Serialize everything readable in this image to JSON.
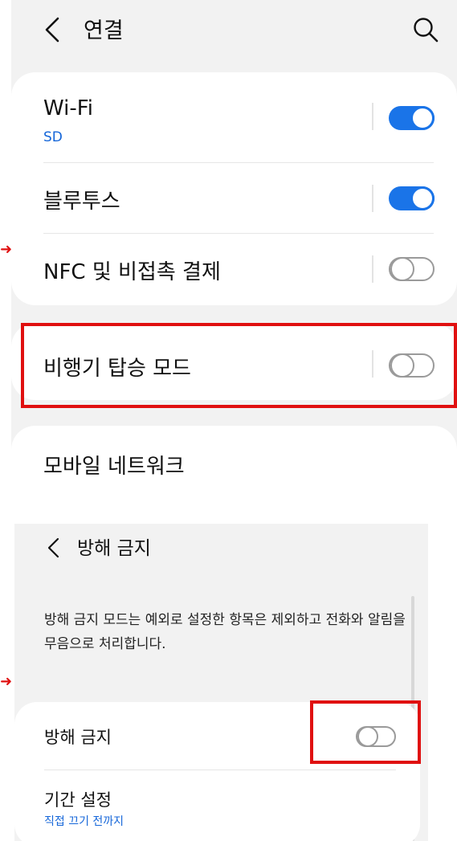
{
  "connections": {
    "header": {
      "back_icon": "chevron-left-icon",
      "title": "연결",
      "search_icon": "search-icon"
    },
    "items": [
      {
        "label": "Wi-Fi",
        "sublabel": "SD",
        "toggle": "on"
      },
      {
        "label": "블루투스",
        "toggle": "on"
      },
      {
        "label": "NFC 및 비접촉 결제",
        "toggle": "off"
      },
      {
        "label": "비행기 탑승 모드",
        "toggle": "off",
        "highlighted": true
      },
      {
        "label": "모바일 네트워크"
      }
    ]
  },
  "dnd": {
    "header": {
      "back_icon": "chevron-left-icon",
      "title": "방해 금지"
    },
    "description": "방해 금지 모드는 예외로 설정한 항목은 제외하고 전화와 알림을 무음으로 처리합니다.",
    "items": [
      {
        "label": "방해 금지",
        "toggle": "off",
        "highlighted": true
      },
      {
        "label": "기간 설정",
        "sublabel": "직접 끄기 전까지"
      }
    ]
  },
  "colors": {
    "accent": "#1a74e8",
    "highlight": "#e01010",
    "panel_bg": "#f2f2f2"
  }
}
